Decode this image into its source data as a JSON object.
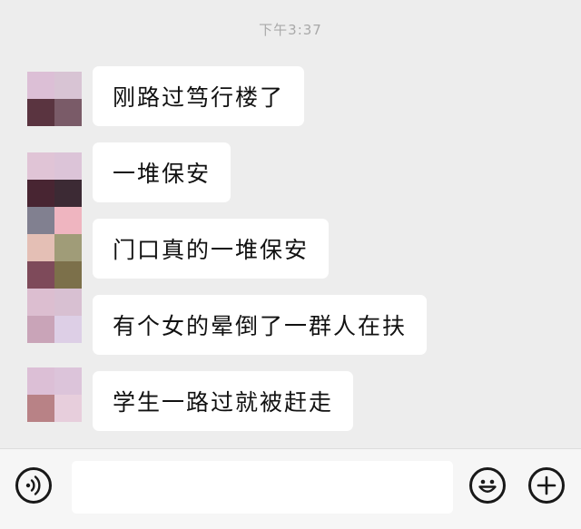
{
  "chat": {
    "timestamp": "下午3:37",
    "messages": [
      {
        "text": "刚路过笃行楼了"
      },
      {
        "text": "一堆保安"
      },
      {
        "text": "门口真的一堆保安"
      },
      {
        "text": "有个女的晕倒了一群人在扶"
      },
      {
        "text": "学生一路过就被赶走"
      }
    ]
  },
  "input_bar": {
    "message_value": "",
    "message_placeholder": "",
    "left_icon": "voice-icon",
    "emoji_icon": "emoji-icon",
    "plus_icon": "plus-icon"
  },
  "colors": {
    "background": "#ededed",
    "bubble": "#ffffff",
    "input_bar": "#f6f6f6",
    "timestamp_text": "#a9a9a9",
    "avatar_pixels": [
      [
        "#dcbfd6",
        "#d8c4d4",
        "#5a3440",
        "#7a5b68"
      ],
      [
        "#e0c4d6",
        "#dcc4d8",
        "#482532",
        "#3c2a34"
      ],
      [
        "#818090",
        "#efb5c0",
        "#e4bfb5",
        "#a09c78",
        "#7e4a5a",
        "#7c704a",
        "#dcbed0",
        "#d8c0d2",
        "#c9a4b8",
        "#ddcfe6"
      ],
      [
        "#dcbfd6",
        "#dcc4da",
        "#b88286",
        "#e7cedc"
      ]
    ]
  }
}
